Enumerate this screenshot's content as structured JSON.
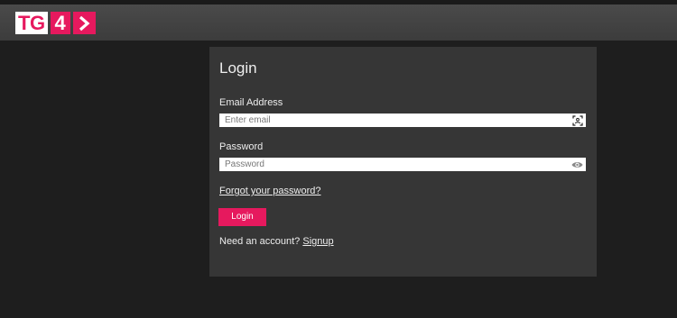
{
  "brand": {
    "logo_text": "TG",
    "logo_number": "4",
    "accent_color": "#e6195e"
  },
  "login": {
    "title": "Login",
    "email_label": "Email Address",
    "email_placeholder": "Enter email",
    "email_icon": "scan-contact-icon",
    "password_label": "Password",
    "password_placeholder": "Password",
    "password_icon": "eye-icon",
    "forgot_link": "Forgot your password?",
    "submit_label": "Login",
    "signup_prompt": "Need an account?",
    "signup_link": "Signup"
  }
}
